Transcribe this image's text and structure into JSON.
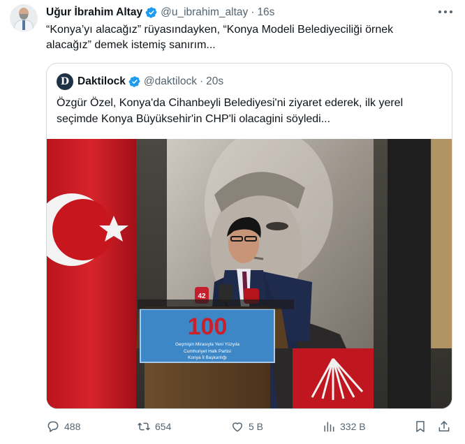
{
  "tweet": {
    "author_name": "Uğur İbrahim Altay",
    "author_handle": "@u_ibrahim_altay",
    "time": "16s",
    "text": "“Konya’yı alacağız” rüyasındayken, “Konya Modeli Belediyeciliği örnek alacağız” demek istemiş sanırım..."
  },
  "quote": {
    "avatar_letter": "D",
    "author_name": "Daktilock",
    "author_handle": "@daktilock",
    "time": "20s",
    "text": "Özgür Özel, Konya'da Cihanbeyli Belediyesi'ni ziyaret ederek, ilk yerel seçimde Konya Büyüksehir'in CHP'li olacagini söyledi...",
    "image": {
      "podium_number": "100",
      "podium_text_1": "Geçmişin Mirasıyla Yeni Yüzyıla",
      "podium_text_2": "Cumhuriyet Halk Partisi",
      "podium_text_3": "Konya İl Başkanlığı"
    }
  },
  "actions": {
    "replies": "488",
    "reposts": "654",
    "likes": "5 B",
    "views": "332 B"
  },
  "colors": {
    "verified_blue": "#1d9bf0",
    "text_primary": "#0f1419",
    "text_secondary": "#536471",
    "border": "#cfd9de"
  },
  "icons": [
    "verified-badge-icon",
    "more-icon",
    "reply-icon",
    "repost-icon",
    "like-icon",
    "views-icon",
    "bookmark-icon",
    "share-icon"
  ]
}
